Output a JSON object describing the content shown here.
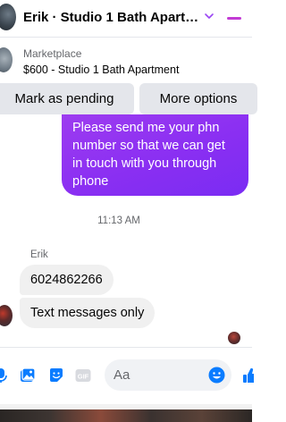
{
  "header": {
    "title": "Erik · Studio 1 Bath Apartment"
  },
  "marketplace": {
    "label": "Marketplace",
    "item": "$600 - Studio 1 Bath Apartment"
  },
  "actions": {
    "mark_pending": "Mark as pending",
    "more_options": "More options"
  },
  "messages": {
    "outgoing": [
      "Please send me your phn",
      "number so that we can get",
      "in touch with you through",
      "phone"
    ],
    "timestamp": "11:13 AM",
    "sender": "Erik",
    "incoming": [
      "6024862266",
      "Text messages only"
    ]
  },
  "composer": {
    "placeholder": "Aa"
  },
  "colors": {
    "accent": "#9b46f3",
    "bubble_outgoing": "#8a2ff2",
    "bubble_incoming": "#f0f0f0",
    "like_blue": "#0a7cff"
  },
  "icons": {
    "chevron": "chevron-down-icon",
    "minimize": "minimize-icon",
    "mic": "microphone-icon",
    "image": "image-icon",
    "sticker": "sticker-icon",
    "gif": "gif-icon",
    "emoji": "emoji-icon",
    "like": "thumbs-up-icon"
  }
}
